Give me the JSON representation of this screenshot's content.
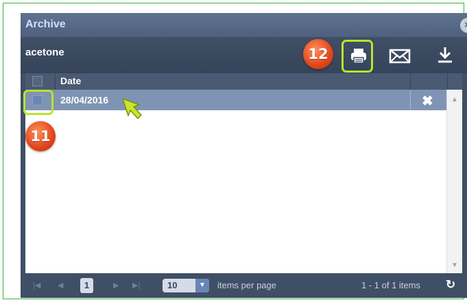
{
  "window": {
    "title": "Archive",
    "close_glyph": "×"
  },
  "toolbar": {
    "label": "acetone",
    "print_icon": "printer-icon",
    "email_icon": "envelope-icon",
    "download_icon": "download-icon"
  },
  "grid": {
    "columns": [
      "Date"
    ],
    "rows": [
      {
        "date": "28/04/2016",
        "selected": true,
        "delete_glyph": "✖"
      }
    ]
  },
  "pager": {
    "first": "|◀",
    "prev": "◀",
    "current_page": "1",
    "next": "▶",
    "last": "▶|",
    "page_size": "10",
    "page_size_arrow": "▼",
    "items_per_page_label": "items per page",
    "info": "1 - 1 of 1 items",
    "refresh_glyph": "↻"
  },
  "annotations": {
    "badge_checkbox": "11",
    "badge_print": "12",
    "highlight_color": "#b9e42a",
    "badge_color": "#e0461c"
  },
  "colors": {
    "window_bg": "#3f4f66",
    "title_text": "#cfe0ff",
    "selected_row": "#7f94b4"
  }
}
